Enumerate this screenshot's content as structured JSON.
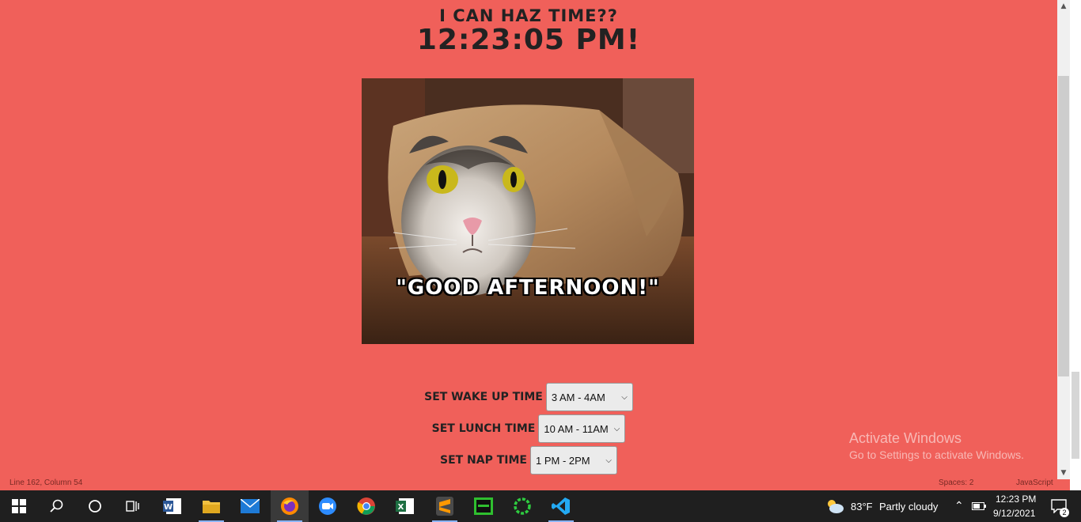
{
  "header": {
    "subtitle": "I CAN HAZ TIME??",
    "clock": "12:23:05 PM!"
  },
  "meme": {
    "caption": "\"GOOD AFTERNOON!\""
  },
  "controls": {
    "wake": {
      "label": "SET WAKE UP TIME",
      "selected": "3 AM - 4AM"
    },
    "lunch": {
      "label": "SET LUNCH TIME",
      "selected": "10 AM - 11AM"
    },
    "nap": {
      "label": "SET NAP TIME",
      "selected": "1 PM - 2PM"
    }
  },
  "watermark": {
    "line1": "Activate Windows",
    "line2": "Go to Settings to activate Windows."
  },
  "editor_status": {
    "position": "Line 162, Column 54",
    "spaces": "Spaces: 2",
    "language": "JavaScript"
  },
  "taskbar": {
    "weather_temp": "83°F",
    "weather_text": "Partly cloudy",
    "time": "12:23 PM",
    "date": "9/12/2021",
    "notification_count": "2",
    "apps": [
      "start-icon",
      "search-icon",
      "cortana-icon",
      "task-view-icon",
      "word-icon",
      "file-explorer-icon",
      "mail-icon",
      "firefox-icon",
      "zoom-icon",
      "chrome-icon",
      "excel-icon",
      "sublime-icon",
      "terminal-icon",
      "loading-icon",
      "vscode-icon"
    ]
  },
  "colors": {
    "background": "#f0605a",
    "text": "#222222",
    "taskbar": "#1f1f1f"
  }
}
